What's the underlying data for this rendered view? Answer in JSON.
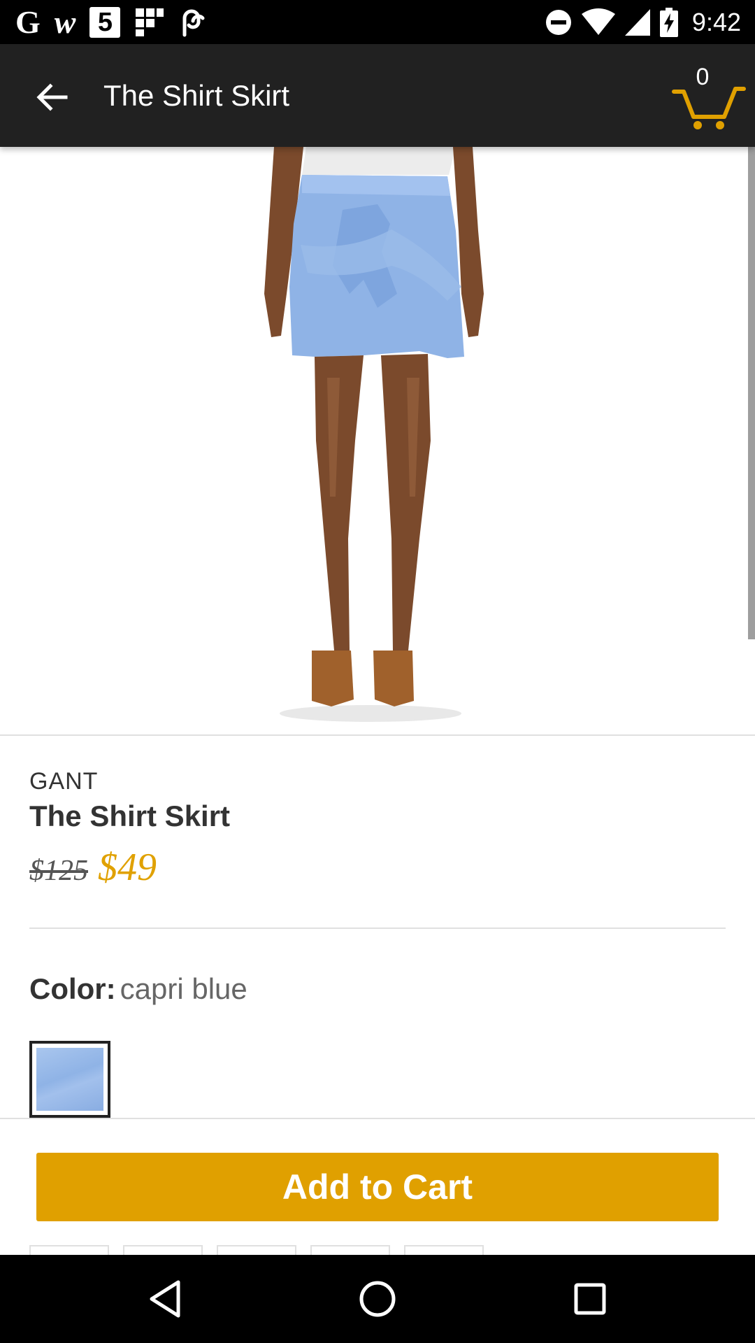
{
  "status_bar": {
    "icons": [
      "google-g-icon",
      "w-icon",
      "channel-5-icon",
      "grid-app-icon",
      "link-icon",
      "do-not-disturb-icon",
      "wifi-icon",
      "signal-icon",
      "battery-charging-icon"
    ],
    "g_glyph": "G",
    "w_glyph": "w",
    "five_glyph": "5",
    "time": "9:42"
  },
  "app_bar": {
    "title": "The Shirt Skirt",
    "cart_count": "0",
    "accent_color": "#e0a000"
  },
  "product": {
    "brand": "GANT",
    "title": "The Shirt Skirt",
    "original_price": "$125",
    "sale_price": "$49",
    "color_label": "Color:",
    "color_value": "capri blue",
    "swatch_color": "#9dbbe9"
  },
  "actions": {
    "add_to_cart_label": "Add to Cart"
  },
  "nav_bar": {
    "icons": [
      "back-triangle-icon",
      "home-circle-icon",
      "recents-square-icon"
    ]
  }
}
